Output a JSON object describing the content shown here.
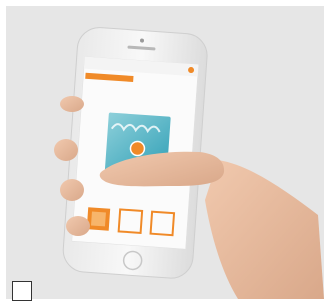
{
  "photo": {
    "subject": "hand-holding-smartphone",
    "phone_color": "#f4f4f4",
    "screen_color": "#fbfbfb",
    "accent_color": "#f08a28",
    "app_card_colors": [
      "#2f9fb6",
      "#7cc4cf"
    ]
  },
  "selection": {
    "checked": false
  }
}
